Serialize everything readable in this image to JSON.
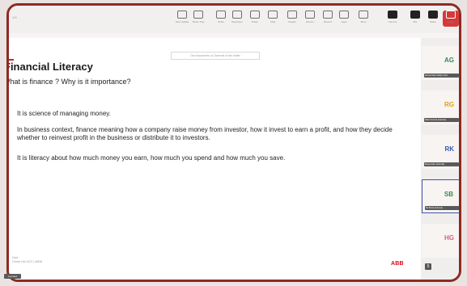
{
  "toolbar": {
    "left_label": "1/9",
    "buttons": [
      {
        "id": "share",
        "label": "New Update",
        "style": "normal"
      },
      {
        "id": "sharetray",
        "label": "Share Tray",
        "style": "normal"
      },
      {
        "id": "notes",
        "label": "Notes",
        "style": "normal"
      },
      {
        "id": "reactions",
        "label": "Reactions",
        "style": "normal"
      },
      {
        "id": "raise",
        "label": "Raise",
        "style": "normal"
      },
      {
        "id": "chat",
        "label": "Chat",
        "style": "normal"
      },
      {
        "id": "people",
        "label": "People",
        "style": "normal"
      },
      {
        "id": "rooms",
        "label": "Rooms",
        "style": "normal"
      },
      {
        "id": "record",
        "label": "Record",
        "style": "normal"
      },
      {
        "id": "apps",
        "label": "Apps",
        "style": "normal"
      },
      {
        "id": "more",
        "label": "More",
        "style": "normal"
      },
      {
        "id": "camera",
        "label": "Camera",
        "style": "dark"
      },
      {
        "id": "mic",
        "label": "Mic",
        "style": "dark"
      },
      {
        "id": "share2",
        "label": "Share",
        "style": "dark"
      },
      {
        "id": "leave",
        "label": "Leave",
        "style": "red"
      }
    ]
  },
  "slide": {
    "banner": "Get documents on General of the buffer",
    "title": "Financial Literacy",
    "subtitle": "What is finance ? Why is it importance?",
    "bullets": [
      "It is science of managing money.",
      "In business context, finance meaning how a company raise money from investor, how it invest to earn a profit, and how they decide whether to reinvest profit in the business or distribute it to investors.",
      "It is literacy about how much money you earn, how much you spend and how much you save."
    ],
    "footer_line1": "Date",
    "footer_line2": "Global Hal 2023  |  ABBB",
    "logo": "ABB"
  },
  "participants": [
    {
      "initials": "AG",
      "name": "Ahmed Ram Dubjin Vortu",
      "color": "#2e8b57",
      "active": false
    },
    {
      "initials": "RG",
      "name": "Rahul Grewal (Internal)",
      "color": "#d7a21c",
      "active": false
    },
    {
      "initials": "RK",
      "name": "Roopa Ram (Internal)",
      "color": "#3b57b0",
      "active": false
    },
    {
      "initials": "SB",
      "name": "Sb Binod (Internal)",
      "color": "#3a8a4e",
      "active": true
    },
    {
      "initials": "HG",
      "name": "",
      "color": "#d2618a",
      "active": false
    }
  ],
  "side_count": "5",
  "bottom_tag": "Leonard"
}
